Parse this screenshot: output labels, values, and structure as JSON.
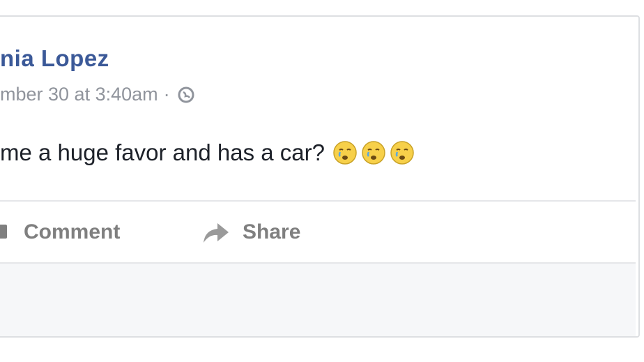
{
  "post": {
    "author": "nia Lopez",
    "timestamp": "mber 30 at 3:40am",
    "separator": "·",
    "privacy_icon": "globe-icon",
    "text": "me a huge favor and has a car?",
    "emojis": [
      "crying-face-icon",
      "crying-face-icon",
      "crying-face-icon"
    ]
  },
  "actions": {
    "comment_label": "Comment",
    "comment_icon": "comment-icon",
    "share_label": "Share",
    "share_icon": "share-arrow-icon"
  },
  "colors": {
    "author": "#3b5998",
    "meta": "#90949c",
    "text": "#1d2129",
    "action": "#7f7f7f",
    "emoji": "#f7d04a"
  }
}
